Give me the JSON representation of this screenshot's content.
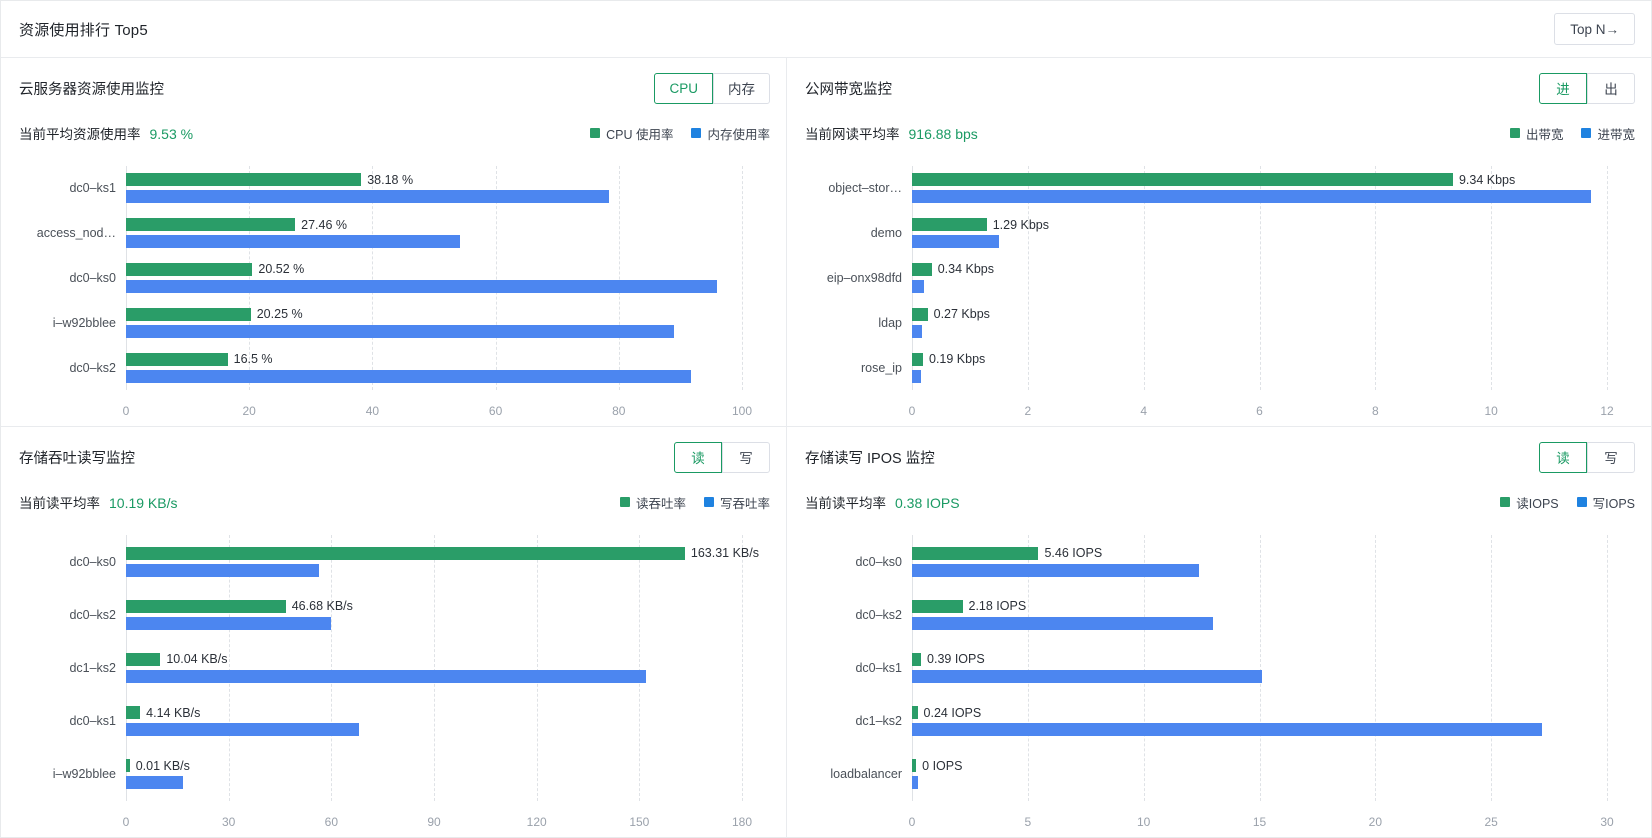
{
  "header": {
    "title": "资源使用排行 Top5",
    "topn_button": "Top N→"
  },
  "colors": {
    "green": "#2a9d68",
    "blue": "#4c86f0",
    "accent": "#1a9a63"
  },
  "panels": [
    {
      "title": "云服务器资源使用监控",
      "toggles": [
        {
          "label": "CPU",
          "active": true
        },
        {
          "label": "内存",
          "active": false
        }
      ],
      "avg_label": "当前平均资源使用率",
      "avg_value": "9.53 %",
      "legend": [
        {
          "label": "CPU 使用率",
          "color": "#2a9d68"
        },
        {
          "label": "内存使用率",
          "color": "#1f82e0"
        }
      ],
      "chart_data": {
        "type": "bar",
        "orientation": "horizontal",
        "title": "云服务器资源使用监控",
        "categories": [
          "dc0–ks1",
          "access_nod…",
          "dc0–ks0",
          "i–w92bblee",
          "dc0–ks2"
        ],
        "series": [
          {
            "name": "CPU 使用率",
            "color": "#2a9d68",
            "values": [
              38.18,
              27.46,
              20.52,
              20.25,
              16.5
            ],
            "labels": [
              "38.18 %",
              "27.46 %",
              "20.52 %",
              "20.25 %",
              "16.5 %"
            ]
          },
          {
            "name": "内存使用率",
            "color": "#4c86f0",
            "values": [
              78.4,
              54.2,
              96.0,
              89.0,
              91.7
            ],
            "labels": [
              "",
              "",
              "",
              "",
              ""
            ]
          }
        ],
        "xticks": [
          "0",
          "20",
          "40",
          "60",
          "80",
          "100"
        ],
        "xlim": [
          0,
          100
        ],
        "xlabel": "",
        "ylabel": "",
        "grid": true,
        "legend_position": "top-right"
      }
    },
    {
      "title": "公网带宽监控",
      "toggles": [
        {
          "label": "进",
          "active": true
        },
        {
          "label": "出",
          "active": false
        }
      ],
      "avg_label": "当前网读平均率",
      "avg_value": "916.88 bps",
      "legend": [
        {
          "label": "出带宽",
          "color": "#2a9d68"
        },
        {
          "label": "进带宽",
          "color": "#1f82e0"
        }
      ],
      "chart_data": {
        "type": "bar",
        "orientation": "horizontal",
        "title": "公网带宽监控",
        "categories": [
          "object–stor…",
          "demo",
          "eip–onx98dfd",
          "ldap",
          "rose_ip"
        ],
        "series": [
          {
            "name": "出带宽",
            "color": "#2a9d68",
            "values": [
              9.34,
              1.29,
              0.34,
              0.27,
              0.19
            ],
            "labels": [
              "9.34 Kbps",
              "1.29 Kbps",
              "0.34 Kbps",
              "0.27 Kbps",
              "0.19 Kbps"
            ]
          },
          {
            "name": "进带宽",
            "color": "#4c86f0",
            "values": [
              11.72,
              1.5,
              0.2,
              0.17,
              0.15
            ],
            "labels": [
              "",
              "",
              "",
              "",
              ""
            ]
          }
        ],
        "xticks": [
          "0",
          "2",
          "4",
          "6",
          "8",
          "10",
          "12"
        ],
        "xlim": [
          0,
          12
        ],
        "xlabel": "",
        "ylabel": "",
        "grid": true,
        "legend_position": "top-right"
      }
    },
    {
      "title": "存储吞吐读写监控",
      "toggles": [
        {
          "label": "读",
          "active": true
        },
        {
          "label": "写",
          "active": false
        }
      ],
      "avg_label": "当前读平均率",
      "avg_value": "10.19 KB/s",
      "legend": [
        {
          "label": "读吞吐率",
          "color": "#2a9d68"
        },
        {
          "label": "写吞吐率",
          "color": "#1f82e0"
        }
      ],
      "chart_data": {
        "type": "bar",
        "orientation": "horizontal",
        "title": "存储吞吐读写监控",
        "categories": [
          "dc0–ks0",
          "dc0–ks2",
          "dc1–ks2",
          "dc0–ks1",
          "i–w92bblee"
        ],
        "series": [
          {
            "name": "读吞吐率",
            "color": "#2a9d68",
            "values": [
              163.31,
              46.68,
              10.04,
              4.14,
              0.01
            ],
            "labels": [
              "163.31 KB/s",
              "46.68 KB/s",
              "10.04 KB/s",
              "4.14 KB/s",
              "0.01 KB/s"
            ]
          },
          {
            "name": "写吞吐率",
            "color": "#4c86f0",
            "values": [
              56.4,
              59.8,
              152.0,
              68.0,
              16.6
            ],
            "labels": [
              "",
              "",
              "",
              "",
              ""
            ]
          }
        ],
        "xticks": [
          "0",
          "30",
          "60",
          "90",
          "120",
          "150",
          "180"
        ],
        "xlim": [
          0,
          180
        ],
        "xlabel": "",
        "ylabel": "",
        "grid": true,
        "legend_position": "top-right"
      }
    },
    {
      "title": "存储读写 IPOS 监控",
      "toggles": [
        {
          "label": "读",
          "active": true
        },
        {
          "label": "写",
          "active": false
        }
      ],
      "avg_label": "当前读平均率",
      "avg_value": "0.38 IOPS",
      "legend": [
        {
          "label": "读IOPS",
          "color": "#2a9d68"
        },
        {
          "label": "写IOPS",
          "color": "#1f82e0"
        }
      ],
      "chart_data": {
        "type": "bar",
        "orientation": "horizontal",
        "title": "存储读写 IPOS 监控",
        "categories": [
          "dc0–ks0",
          "dc0–ks2",
          "dc0–ks1",
          "dc1–ks2",
          "loadbalancer"
        ],
        "series": [
          {
            "name": "读IOPS",
            "color": "#2a9d68",
            "values": [
              5.46,
              2.18,
              0.39,
              0.24,
              0
            ],
            "labels": [
              "5.46 IOPS",
              "2.18 IOPS",
              "0.39 IOPS",
              "0.24 IOPS",
              "0 IOPS"
            ]
          },
          {
            "name": "写IOPS",
            "color": "#4c86f0",
            "values": [
              12.4,
              13.0,
              15.1,
              27.2,
              0.25
            ],
            "labels": [
              "",
              "",
              "",
              "",
              ""
            ]
          }
        ],
        "xticks": [
          "0",
          "5",
          "10",
          "15",
          "20",
          "25",
          "30"
        ],
        "xlim": [
          0,
          30
        ],
        "xlabel": "",
        "ylabel": "",
        "grid": true,
        "legend_position": "top-right"
      }
    }
  ]
}
